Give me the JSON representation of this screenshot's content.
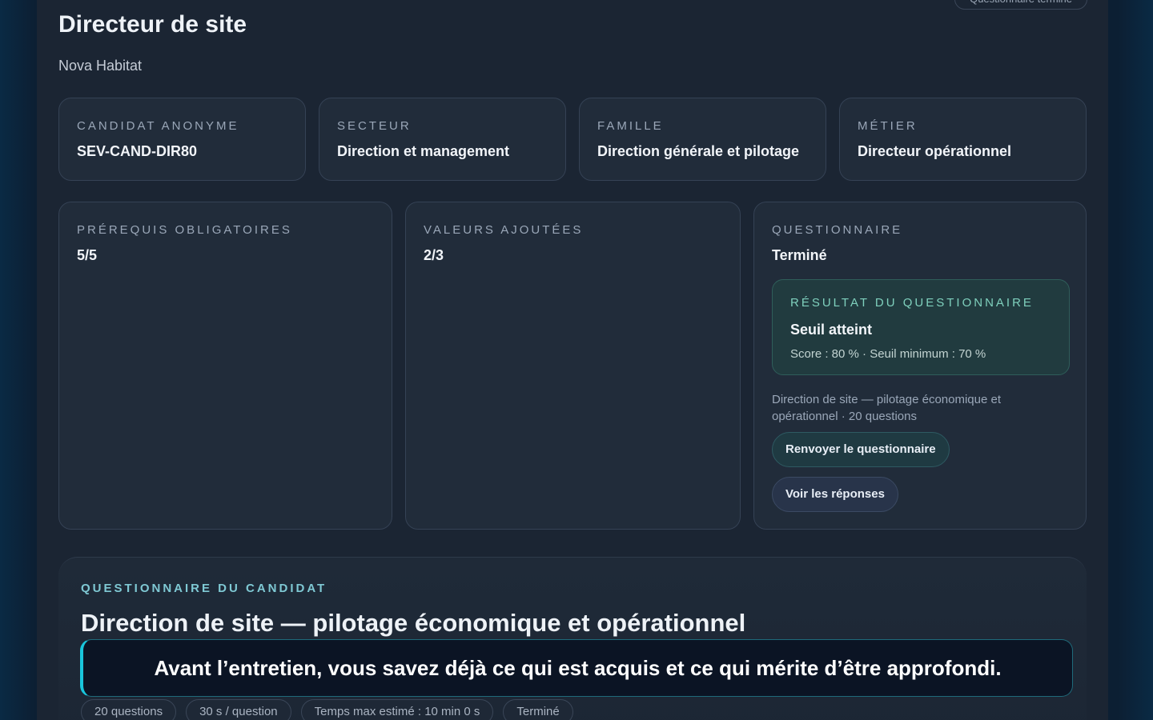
{
  "header": {
    "status_pill": "Questionnaire terminé",
    "title": "Directeur de site",
    "company": "Nova Habitat"
  },
  "info_cards": [
    {
      "label": "Candidat anonyme",
      "value": "SEV-CAND-DIR80"
    },
    {
      "label": "Secteur",
      "value": "Direction et management"
    },
    {
      "label": "Famille",
      "value": "Direction générale et pilotage"
    },
    {
      "label": "Métier",
      "value": "Directeur opérationnel"
    }
  ],
  "prerequis": {
    "label": "Prérequis obligatoires",
    "value": "5/5"
  },
  "valeurs": {
    "label": "Valeurs ajoutées",
    "value": "2/3"
  },
  "questionnaire": {
    "label": "Questionnaire",
    "value": "Terminé",
    "result": {
      "label": "Résultat du questionnaire",
      "value": "Seuil atteint",
      "detail": "Score : 80 % · Seuil minimum : 70 %"
    },
    "description": "Direction de site — pilotage économique et opérationnel · 20 questions",
    "resend_button": "Renvoyer le questionnaire",
    "answers_button": "Voir les réponses"
  },
  "candidate_section": {
    "label": "Questionnaire du candidat",
    "title": "Direction de site — pilotage économique et opérationnel",
    "chips": [
      "20 questions",
      "30 s / question",
      "Temps max estimé : 10 min 0 s",
      "Terminé"
    ]
  },
  "banner": {
    "text": "Avant l’entretien, vous savez déjà ce qui est acquis et ce qui mérite d’être approfondi."
  },
  "colors": {
    "accent_teal": "#19c6dc",
    "success_green": "#7fd0bd",
    "card_bg": "#212c3a"
  }
}
